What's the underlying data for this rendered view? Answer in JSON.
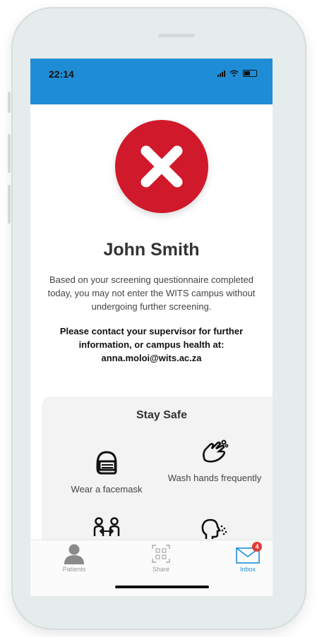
{
  "status_bar": {
    "time": "22:14",
    "icons": [
      "signal-icon",
      "wifi-icon",
      "battery-icon"
    ]
  },
  "result": {
    "status_icon": "denied-x-icon",
    "status_color": "#d0192a",
    "name": "John Smith",
    "message": "Based on your screening questionnaire completed today, you may not enter the WITS campus without undergoing further screening.",
    "contact": "Please contact your supervisor for further information, or campus health at: anna.moloi@wits.ac.za"
  },
  "stay_safe": {
    "title": "Stay Safe",
    "tips": [
      {
        "icon": "facemask-icon",
        "label": "Wear a facemask"
      },
      {
        "icon": "wash-hands-icon",
        "label": "Wash hands frequently"
      },
      {
        "icon": "social-distance-icon",
        "label": ""
      },
      {
        "icon": "cough-icon",
        "label": ""
      }
    ]
  },
  "tab_bar": {
    "tabs": [
      {
        "icon": "patients-icon",
        "label": "Patients",
        "active": false
      },
      {
        "icon": "qr-share-icon",
        "label": "Share",
        "active": false
      },
      {
        "icon": "inbox-icon",
        "label": "Inbox",
        "active": true,
        "badge": "4"
      }
    ]
  },
  "colors": {
    "accent": "#1f8dd6",
    "badge": "#e53935"
  }
}
